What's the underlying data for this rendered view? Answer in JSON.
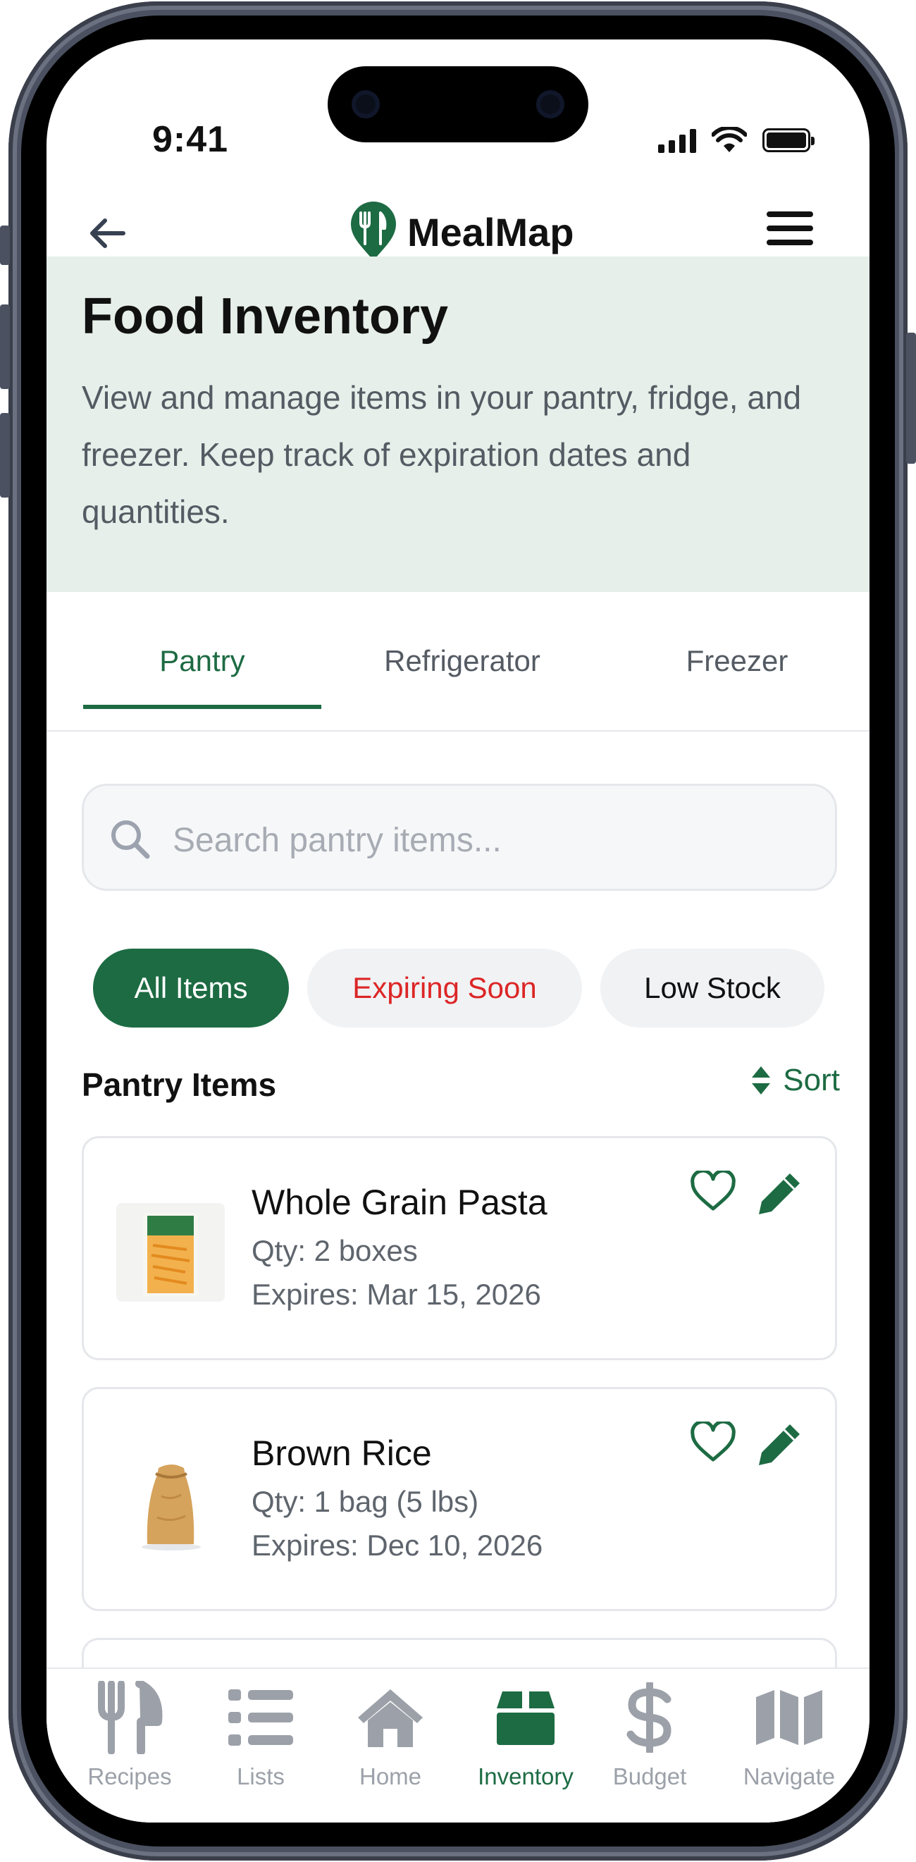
{
  "status_bar": {
    "time": "9:41"
  },
  "header": {
    "app_name": "MealMap"
  },
  "hero": {
    "title": "Food Inventory",
    "description": "View and manage items in your pantry, fridge, and freezer. Keep track of expiration dates and quantities."
  },
  "tabs": [
    {
      "label": "Pantry",
      "active": true
    },
    {
      "label": "Refrigerator",
      "active": false
    },
    {
      "label": "Freezer",
      "active": false
    }
  ],
  "search": {
    "placeholder": "Search pantry items..."
  },
  "filters": [
    {
      "label": "All Items",
      "active": true
    },
    {
      "label": "Expiring Soon",
      "active": false,
      "color": "#dc2626"
    },
    {
      "label": "Low Stock",
      "active": false
    }
  ],
  "section": {
    "title": "Pantry Items",
    "sort_label": "Sort"
  },
  "items": [
    {
      "name": "Whole Grain Pasta",
      "qty": "Qty: 2 boxes",
      "expires": "Expires: Mar 15, 2026"
    },
    {
      "name": "Brown Rice",
      "qty": "Qty: 1 bag (5 lbs)",
      "expires": "Expires: Dec 10, 2026"
    }
  ],
  "bottom_nav": [
    {
      "label": "Recipes",
      "icon": "utensils-icon",
      "active": false
    },
    {
      "label": "Lists",
      "icon": "list-icon",
      "active": false
    },
    {
      "label": "Home",
      "icon": "home-icon",
      "active": false
    },
    {
      "label": "Inventory",
      "icon": "box-icon",
      "active": true
    },
    {
      "label": "Budget",
      "icon": "dollar-icon",
      "active": false
    },
    {
      "label": "Navigate",
      "icon": "map-icon",
      "active": false
    }
  ],
  "colors": {
    "brand_green": "#1d6b43",
    "hero_bg": "#e7efea",
    "expiring_red": "#dc2626",
    "inactive_nav": "#9ca1a9"
  }
}
